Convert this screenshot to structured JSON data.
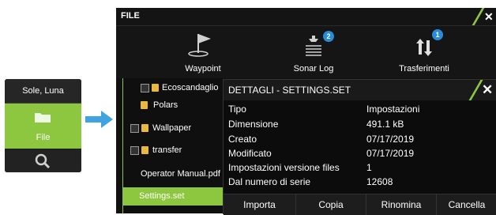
{
  "side_menu": {
    "items": [
      {
        "label": "Sole, Luna"
      },
      {
        "label": "File"
      },
      {
        "label": ""
      }
    ]
  },
  "window": {
    "title": "FILE",
    "tools": [
      {
        "label": "Waypoint"
      },
      {
        "label": "Sonar Log",
        "badge": "2"
      },
      {
        "label": "Trasferimenti",
        "badge": "1"
      }
    ],
    "files": [
      {
        "name": "Ecoscandaglio"
      },
      {
        "name": "Polars"
      },
      {
        "name": "Wallpaper"
      },
      {
        "name": "transfer"
      },
      {
        "name": "Operator Manual.pdf"
      },
      {
        "name": "Settings.set"
      }
    ]
  },
  "dialog": {
    "title": "DETTAGLI - SETTINGS.SET",
    "fields": [
      {
        "key": "Tipo",
        "value": "Impostazioni"
      },
      {
        "key": "Dimensione",
        "value": "491.1 kB"
      },
      {
        "key": "Creato",
        "value": "07/17/2019"
      },
      {
        "key": "Modificato",
        "value": "07/17/2019"
      },
      {
        "key": "Impostazioni versione files",
        "value": "1"
      },
      {
        "key": "Dal numero di serie",
        "value": "12608"
      }
    ],
    "buttons": [
      {
        "label": "Importa"
      },
      {
        "label": "Copia"
      },
      {
        "label": "Rinomina"
      },
      {
        "label": "Cancella"
      }
    ]
  },
  "colors": {
    "accent": "#8dc63f",
    "badge": "#2a8cd8",
    "arrow": "#3fa3e0"
  }
}
